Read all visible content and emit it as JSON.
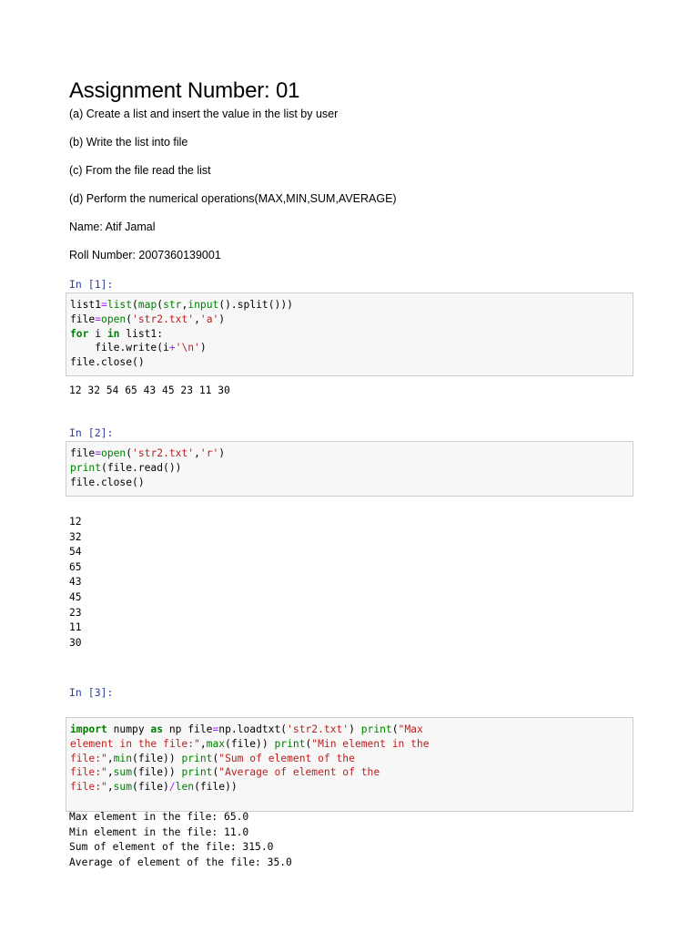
{
  "title": "Assignment Number: 01",
  "tasks": [
    "(a)  Create a list and insert the value in the list by user",
    "(b)  Write the list into file",
    "(c)  From the file read the list",
    "(d)  Perform the numerical operations(MAX,MIN,SUM,AVERAGE)"
  ],
  "name_line": "Name: Atif Jamal",
  "roll_line": "Roll Number: 2007360139001",
  "cells": [
    {
      "prompt": "In [1]:",
      "code_lines": [
        [
          {
            "t": "list1",
            "c": "t"
          },
          {
            "t": "=",
            "c": "o"
          },
          {
            "t": "list",
            "c": "b"
          },
          {
            "t": "(",
            "c": "t"
          },
          {
            "t": "map",
            "c": "b"
          },
          {
            "t": "(",
            "c": "t"
          },
          {
            "t": "str",
            "c": "b"
          },
          {
            "t": ",",
            "c": "t"
          },
          {
            "t": "input",
            "c": "b"
          },
          {
            "t": "().split()))",
            "c": "t"
          }
        ],
        [
          {
            "t": "file",
            "c": "t"
          },
          {
            "t": "=",
            "c": "o"
          },
          {
            "t": "open",
            "c": "b"
          },
          {
            "t": "(",
            "c": "t"
          },
          {
            "t": "'str2.txt'",
            "c": "s"
          },
          {
            "t": ",",
            "c": "t"
          },
          {
            "t": "'a'",
            "c": "s"
          },
          {
            "t": ")",
            "c": "t"
          }
        ],
        [
          {
            "t": "for",
            "c": "k"
          },
          {
            "t": " i ",
            "c": "t"
          },
          {
            "t": "in",
            "c": "k"
          },
          {
            "t": " list1:",
            "c": "t"
          }
        ],
        [
          {
            "t": "    file.write(i",
            "c": "t"
          },
          {
            "t": "+",
            "c": "o"
          },
          {
            "t": "'\\n'",
            "c": "s"
          },
          {
            "t": ")",
            "c": "t"
          }
        ],
        [
          {
            "t": "file.close()",
            "c": "t"
          }
        ]
      ],
      "output_lines": [
        "12 32 54 65 43 45 23 11 30"
      ]
    },
    {
      "prompt": "In [2]:",
      "code_lines": [
        [
          {
            "t": "file",
            "c": "t"
          },
          {
            "t": "=",
            "c": "o"
          },
          {
            "t": "open",
            "c": "b"
          },
          {
            "t": "(",
            "c": "t"
          },
          {
            "t": "'str2.txt'",
            "c": "s"
          },
          {
            "t": ",",
            "c": "t"
          },
          {
            "t": "'r'",
            "c": "s"
          },
          {
            "t": ")",
            "c": "t"
          }
        ],
        [
          {
            "t": "print",
            "c": "b"
          },
          {
            "t": "(file.read())",
            "c": "t"
          }
        ],
        [
          {
            "t": "file.close()",
            "c": "t"
          }
        ]
      ],
      "output_lines": [
        "12",
        "32",
        "54",
        "65",
        "43",
        "45",
        "23",
        "11",
        "30"
      ]
    },
    {
      "prompt": "In [3]:",
      "code_lines": [
        [
          {
            "t": "import",
            "c": "k"
          },
          {
            "t": " numpy ",
            "c": "t"
          },
          {
            "t": "as",
            "c": "k"
          },
          {
            "t": " np file",
            "c": "t"
          },
          {
            "t": "=",
            "c": "o"
          },
          {
            "t": "np.loadtxt(",
            "c": "t"
          },
          {
            "t": "'str2.txt'",
            "c": "s"
          },
          {
            "t": ") ",
            "c": "t"
          },
          {
            "t": "print",
            "c": "b"
          },
          {
            "t": "(",
            "c": "t"
          },
          {
            "t": "\"Max",
            "c": "s"
          }
        ],
        [
          {
            "t": "element in the file:\"",
            "c": "s"
          },
          {
            "t": ",",
            "c": "t"
          },
          {
            "t": "max",
            "c": "b"
          },
          {
            "t": "(file)) ",
            "c": "t"
          },
          {
            "t": "print",
            "c": "b"
          },
          {
            "t": "(",
            "c": "t"
          },
          {
            "t": "\"Min element in the",
            "c": "s"
          }
        ],
        [
          {
            "t": "file:\"",
            "c": "s"
          },
          {
            "t": ",",
            "c": "t"
          },
          {
            "t": "min",
            "c": "b"
          },
          {
            "t": "(file)) ",
            "c": "t"
          },
          {
            "t": "print",
            "c": "b"
          },
          {
            "t": "(",
            "c": "t"
          },
          {
            "t": "\"Sum of element of the",
            "c": "s"
          }
        ],
        [
          {
            "t": "file:\"",
            "c": "s"
          },
          {
            "t": ",",
            "c": "t"
          },
          {
            "t": "sum",
            "c": "b"
          },
          {
            "t": "(file)) ",
            "c": "t"
          },
          {
            "t": "print",
            "c": "b"
          },
          {
            "t": "(",
            "c": "t"
          },
          {
            "t": "\"Average of element of the",
            "c": "s"
          }
        ],
        [
          {
            "t": "file:\"",
            "c": "s"
          },
          {
            "t": ",",
            "c": "t"
          },
          {
            "t": "sum",
            "c": "b"
          },
          {
            "t": "(file)",
            "c": "t"
          },
          {
            "t": "/",
            "c": "o"
          },
          {
            "t": "len",
            "c": "b"
          },
          {
            "t": "(file))",
            "c": "t"
          }
        ]
      ],
      "output_lines": [
        "Max element in the file: 65.0",
        "Min element in the file: 11.0",
        "Sum of element of the file: 315.0",
        "Average of element of the file: 35.0"
      ]
    }
  ]
}
